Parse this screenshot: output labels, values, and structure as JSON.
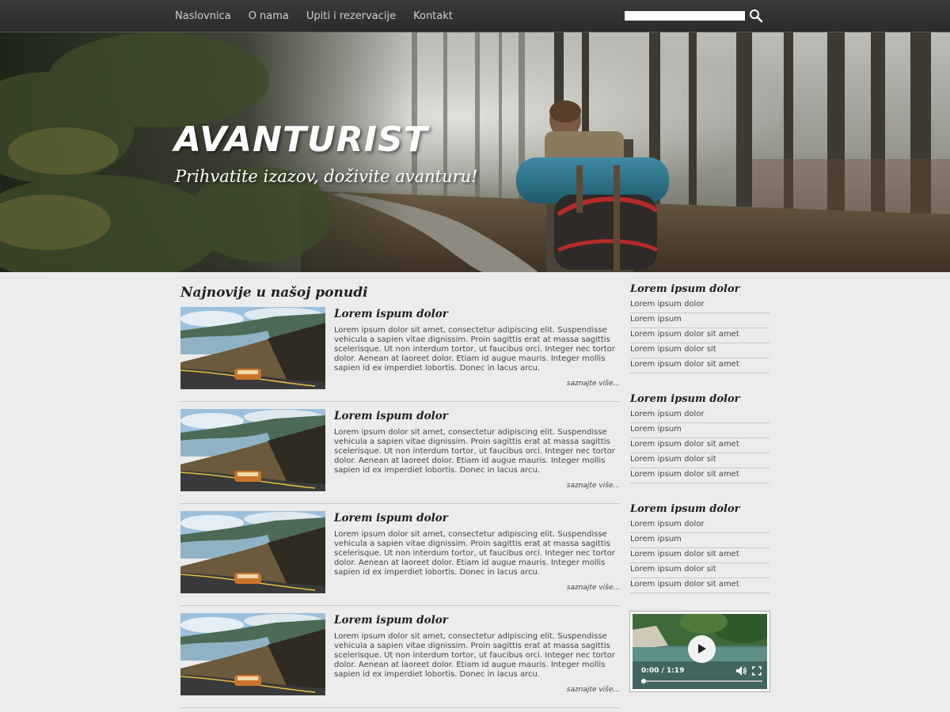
{
  "nav": {
    "items": [
      "Naslovnica",
      "O nama",
      "Upiti i rezervacije",
      "Kontakt"
    ],
    "search_placeholder": "",
    "search_icon": "magnifier-icon"
  },
  "hero": {
    "title": "AVANTURIST",
    "subtitle": "Prihvatite izazov, doživite avanturu!"
  },
  "main": {
    "title": "Najnovije u našoj ponudi",
    "articles": [
      {
        "title": "Lorem ispum dolor",
        "text": "Lorem ipsum dolor sit amet, consectetur adipiscing elit. Suspendisse vehicula a sapien vitae dignissim. Proin sagittis erat at massa sagittis scelerisque. Ut non interdum tortor, ut faucibus orci. Integer nec tortor dolor. Aenean at laoreet dolor. Etiam id augue mauris. Integer mollis sapien id ex imperdiet lobortis. Donec in lacus arcu.",
        "more": "saznajte više..."
      },
      {
        "title": "Lorem ispum dolor",
        "text": "Lorem ipsum dolor sit amet, consectetur adipiscing elit. Suspendisse vehicula a sapien vitae dignissim. Proin sagittis erat at massa sagittis scelerisque. Ut non interdum tortor, ut faucibus orci. Integer nec tortor dolor. Aenean at laoreet dolor. Etiam id augue mauris. Integer mollis sapien id ex imperdiet lobortis. Donec in lacus arcu.",
        "more": "saznajte više..."
      },
      {
        "title": "Lorem ispum dolor",
        "text": "Lorem ipsum dolor sit amet, consectetur adipiscing elit. Suspendisse vehicula a sapien vitae dignissim. Proin sagittis erat at massa sagittis scelerisque. Ut non interdum tortor, ut faucibus orci. Integer nec tortor dolor. Aenean at laoreet dolor. Etiam id augue mauris. Integer mollis sapien id ex imperdiet lobortis. Donec in lacus arcu.",
        "more": "saznajte više..."
      },
      {
        "title": "Lorem ispum dolor",
        "text": "Lorem ipsum dolor sit amet, consectetur adipiscing elit. Suspendisse vehicula a sapien vitae dignissim. Proin sagittis erat at massa sagittis scelerisque. Ut non interdum tortor, ut faucibus orci. Integer nec tortor dolor. Aenean at laoreet dolor. Etiam id augue mauris. Integer mollis sapien id ex imperdiet lobortis. Donec in lacus arcu.",
        "more": "saznajte više..."
      }
    ]
  },
  "sidebar": {
    "blocks": [
      {
        "title": "Lorem ipsum dolor",
        "links": [
          "Lorem ipsum dolor",
          "Lorem ipsum",
          "Lorem ipsum dolor sit amet",
          "Lorem ipsum dolor sit",
          "Lorem ipsum dolor sit amet"
        ]
      },
      {
        "title": "Lorem ipsum dolor",
        "links": [
          "Lorem ipsum dolor",
          "Lorem ipsum",
          "Lorem ipsum dolor sit amet",
          "Lorem ipsum dolor sit",
          "Lorem ipsum dolor sit amet"
        ]
      },
      {
        "title": "Lorem ipsum dolor",
        "links": [
          "Lorem ipsum dolor",
          "Lorem ipsum",
          "Lorem ipsum dolor sit amet",
          "Lorem ipsum dolor sit",
          "Lorem ipsum dolor sit amet"
        ]
      }
    ]
  },
  "video": {
    "time": "0:00 / 1:19",
    "progress": 0,
    "play_icon": "play-icon",
    "volume_icon": "volume-icon",
    "fullscreen_icon": "fullscreen-icon"
  }
}
